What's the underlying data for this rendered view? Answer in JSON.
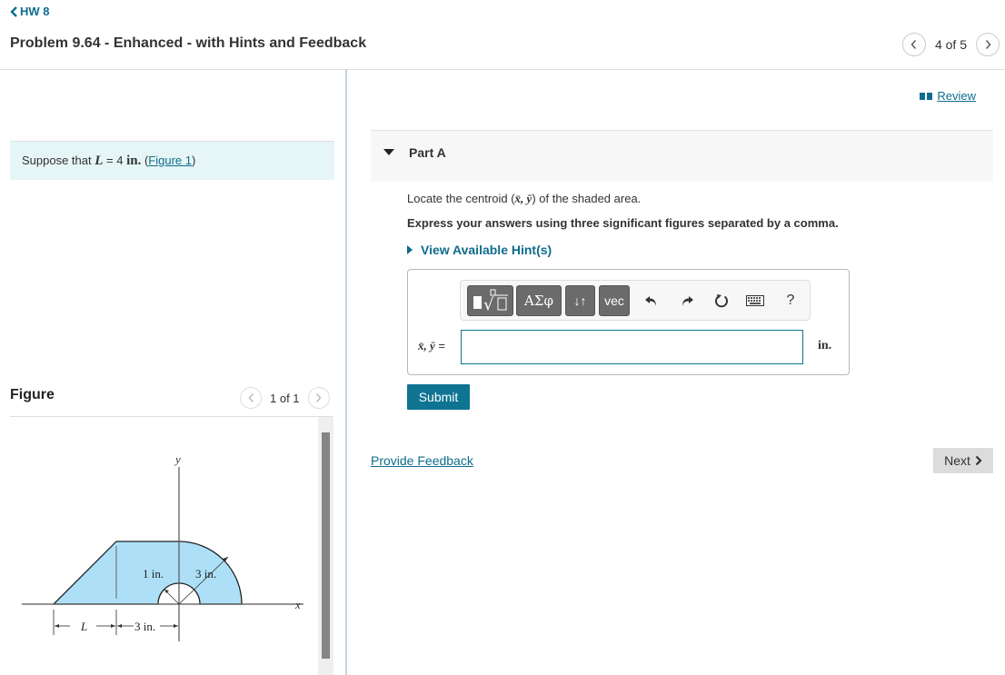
{
  "nav": {
    "back_label": "HW 8",
    "title": "Problem 9.64 - Enhanced - with Hints and Feedback",
    "position": "4 of 5"
  },
  "review": {
    "icon": "book-icon",
    "label": "Review"
  },
  "intro": {
    "prefix": "Suppose that ",
    "variable": "L",
    "equals": " = 4 ",
    "unit": "in.",
    "space": " (",
    "figure_link": "Figure 1",
    "suffix": ")"
  },
  "figure_panel": {
    "title": "Figure",
    "position": "1 of 1",
    "labels": {
      "y_axis": "y",
      "x_axis": "x",
      "inner_radius": "1 in.",
      "outer_radius": "3 in.",
      "length_L": "L",
      "length_3": "3 in."
    },
    "fill_color": "#ade0f7"
  },
  "part": {
    "label": "Part A",
    "question_prefix": "Locate the centroid (",
    "question_vars": "x̄, ȳ",
    "question_suffix": ") of the shaded area.",
    "instruction": "Express your answers using three significant figures separated by a comma.",
    "hint_label": "View Available Hint(s)"
  },
  "toolbar": {
    "templates_label": "▮√□",
    "greek_label": "ΑΣφ",
    "arrows_label": "↓↑",
    "vec_label": "vec",
    "help_label": "?"
  },
  "answer": {
    "label_vars": "x̄, ȳ",
    "label_eq": " =",
    "value": "",
    "unit": "in."
  },
  "buttons": {
    "submit": "Submit",
    "feedback": "Provide Feedback",
    "next": "Next"
  },
  "colors": {
    "accent": "#0f7491",
    "link": "#0f6c8c",
    "intro_bg": "#e6f5f6",
    "shape_fill": "#ade0f7"
  }
}
